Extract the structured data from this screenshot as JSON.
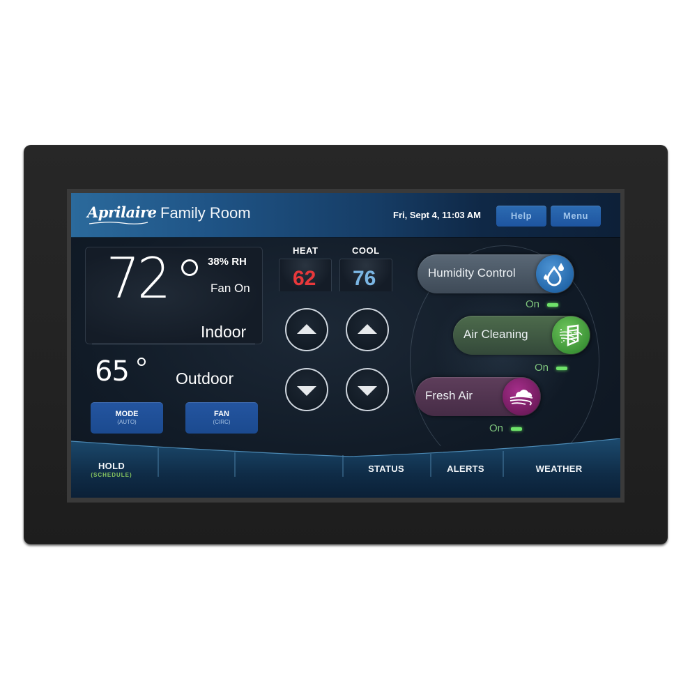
{
  "header": {
    "brand": "Aprilaire",
    "room": "Family Room",
    "datetime": "Fri, Sept 4, 11:03 AM",
    "help_label": "Help",
    "menu_label": "Menu"
  },
  "indoor": {
    "temperature": "72",
    "humidity": "38% RH",
    "fan_status": "Fan On",
    "label": "Indoor"
  },
  "outdoor": {
    "temperature": "65",
    "label": "Outdoor"
  },
  "controls": {
    "mode": {
      "label": "MODE",
      "value": "(AUTO)"
    },
    "fan": {
      "label": "FAN",
      "value": "(CIRC)"
    }
  },
  "setpoints": {
    "heat": {
      "label": "HEAT",
      "value": "62",
      "color": "#e8383b"
    },
    "cool": {
      "label": "COOL",
      "value": "76",
      "color": "#7bb6e4"
    }
  },
  "toggles": [
    {
      "label": "Humidity Control",
      "status": "On",
      "icon": "water-drops-icon",
      "color": "#2165a8"
    },
    {
      "label": "Air Cleaning",
      "status": "On",
      "icon": "air-filter-icon",
      "color": "#3a9135"
    },
    {
      "label": "Fresh Air",
      "status": "On",
      "icon": "cloud-wind-icon",
      "color": "#6e1a5b"
    }
  ],
  "bottom_nav": {
    "hold": {
      "label": "HOLD",
      "sub": "(SCHEDULE)"
    },
    "status": "STATUS",
    "alerts": "ALERTS",
    "weather": "WEATHER"
  }
}
